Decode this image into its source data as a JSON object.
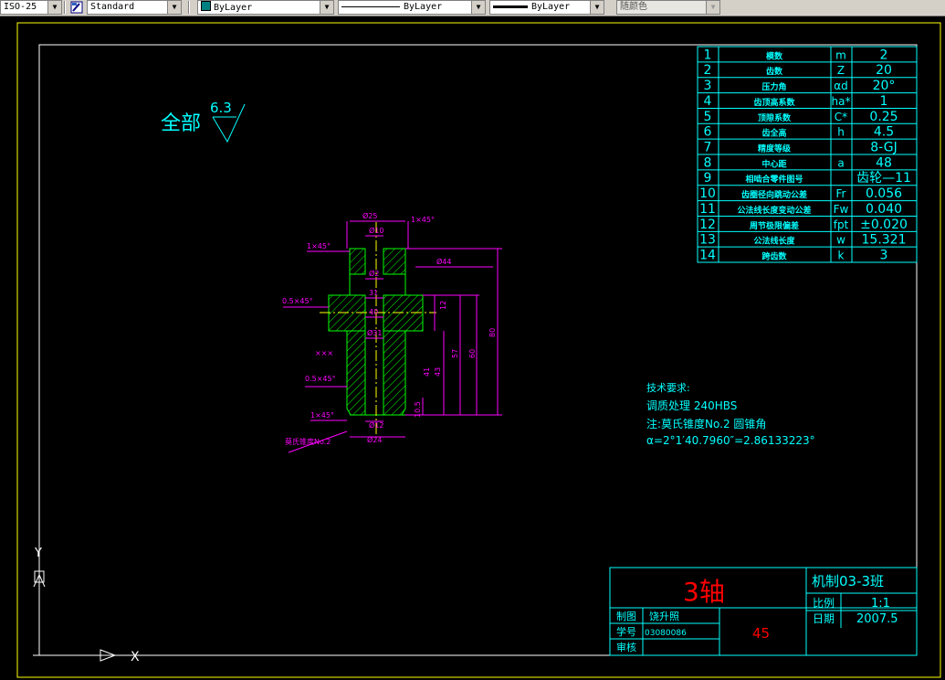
{
  "toolbar": {
    "dimstyle": "ISO-25",
    "textstyle": "Standard",
    "layer": "ByLayer",
    "linetype": "ByLayer",
    "lineweight": "ByLayer",
    "plotstyle": "随颜色"
  },
  "drawing": {
    "roughness_label": "全部",
    "roughness_value": "6.3",
    "params": [
      {
        "n": "1",
        "name": "模数",
        "sym": "m",
        "val": "2"
      },
      {
        "n": "2",
        "name": "齿数",
        "sym": "Z",
        "val": "20"
      },
      {
        "n": "3",
        "name": "压力角",
        "sym": "αd",
        "val": "20°"
      },
      {
        "n": "4",
        "name": "齿顶高系数",
        "sym": "ha*",
        "val": "1"
      },
      {
        "n": "5",
        "name": "顶隙系数",
        "sym": "C*",
        "val": "0.25"
      },
      {
        "n": "6",
        "name": "齿全高",
        "sym": "h",
        "val": "4.5"
      },
      {
        "n": "7",
        "name": "精度等级",
        "sym": "",
        "val": "8-GJ"
      },
      {
        "n": "8",
        "name": "中心距",
        "sym": "a",
        "val": "48"
      },
      {
        "n": "9",
        "name": "相啮合零件图号",
        "sym": "",
        "val": "齿轮—11"
      },
      {
        "n": "10",
        "name": "齿圈径向跳动公差",
        "sym": "Fr",
        "val": "0.056"
      },
      {
        "n": "11",
        "name": "公法线长度变动公差",
        "sym": "Fw",
        "val": "0.040"
      },
      {
        "n": "12",
        "name": "周节极限偏差",
        "sym": "fpt",
        "val": "±0.020"
      },
      {
        "n": "13",
        "name": "公法线长度",
        "sym": "w",
        "val": "15.321"
      },
      {
        "n": "14",
        "name": "跨齿数",
        "sym": "k",
        "val": "3"
      }
    ],
    "tech_title": "技术要求:",
    "tech_lines": [
      "调质处理 240HBS",
      "注:莫氏锥度No.2 圆锥角",
      "α=2°1′40.7960″=2.86133223°"
    ],
    "dims": {
      "d25": "Ø25",
      "d10": "Ø10",
      "d44": "Ø44",
      "d2": "Ø2",
      "d31": "31",
      "d40": "40",
      "d31b": "Ø31",
      "d12": "Ø12",
      "d24": "Ø24",
      "c1": "1×45°",
      "c2": "1×45°",
      "c3": "0.5×45°",
      "c4": "0.5×45°",
      "c5": "1×45°",
      "v12": "12",
      "v41": "41",
      "v43": "43",
      "v57": "57",
      "v60": "60",
      "v80": "80",
      "v105": "10.5",
      "taper": "莫氏锥度No.2",
      "mark": "×××"
    },
    "title_block": {
      "part_name": "3轴",
      "class_name": "机制03-3班",
      "scale_label": "比例",
      "scale": "1:1",
      "date_label": "日期",
      "date": "2007.5",
      "drawn_label": "制图",
      "drawn_by": "饶升照",
      "id_label": "学号",
      "student_id": "03080086",
      "check_label": "审核",
      "material": "45"
    },
    "ucs": {
      "y": "Y",
      "x": "X"
    }
  },
  "colors": {
    "border": "#ffffff",
    "table": "#00ffff",
    "hatch": "#00ff00",
    "dims": "#ff00ff",
    "centerline": "#ffff00",
    "title_red": "#ff0000",
    "cad_bg": "#000000"
  }
}
